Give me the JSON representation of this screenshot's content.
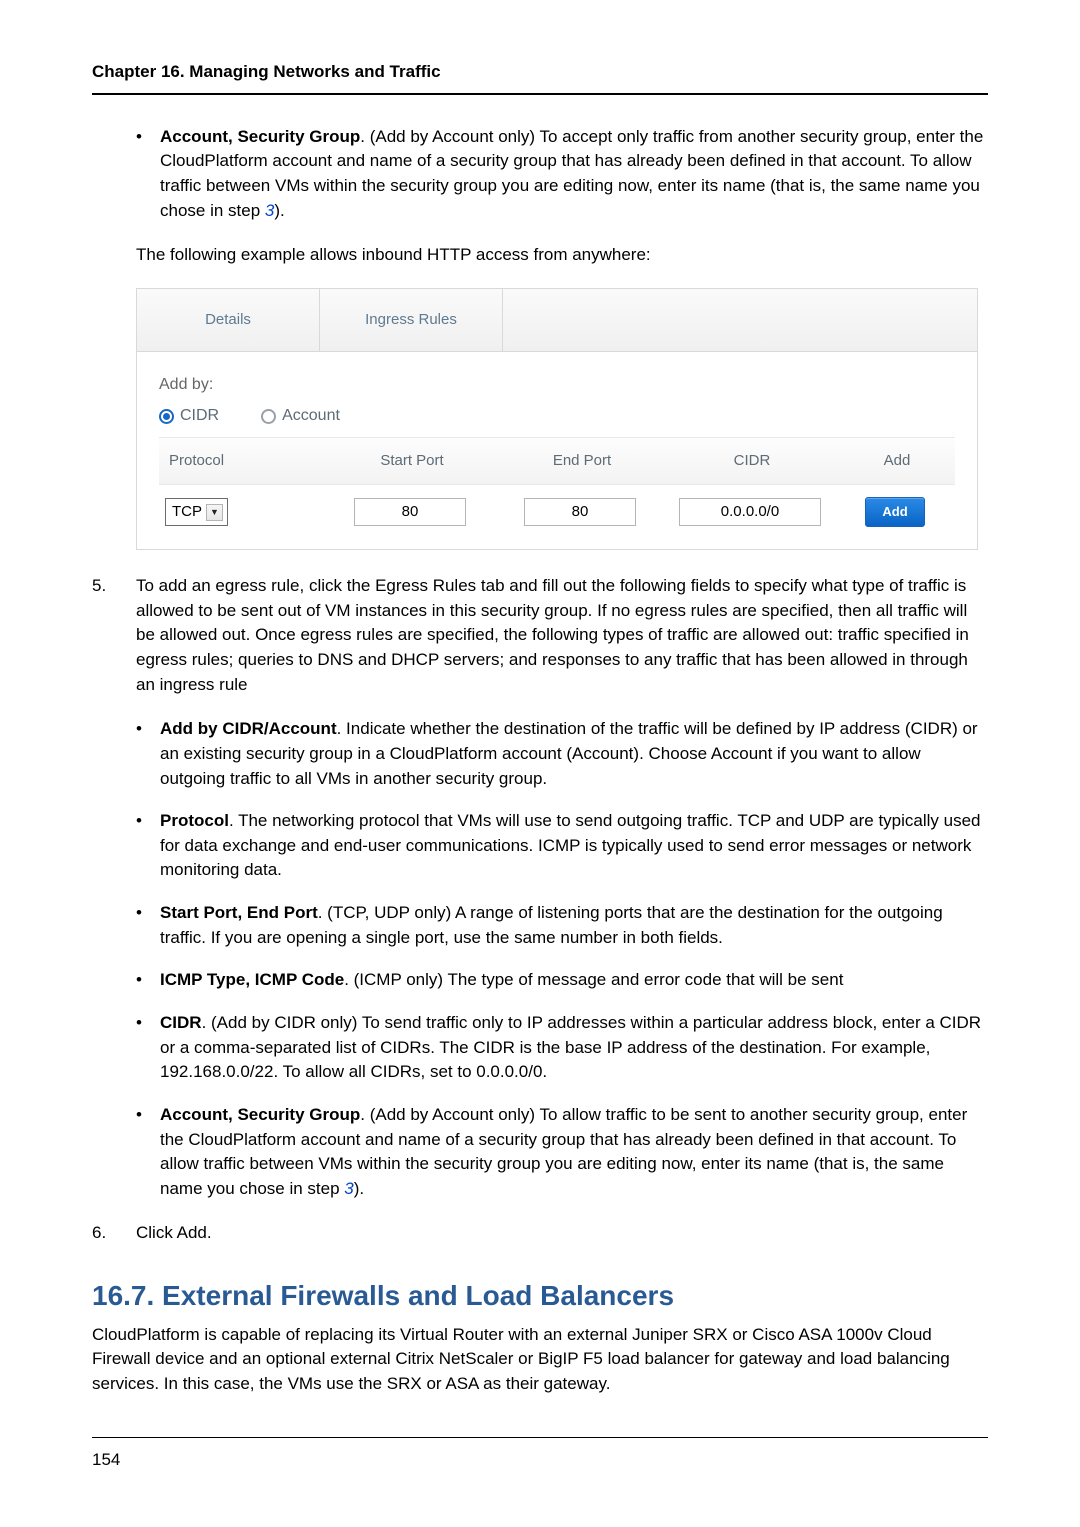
{
  "page": {
    "chapter_header": "Chapter 16. Managing Networks and Traffic",
    "page_number": "154"
  },
  "intro_bullet": {
    "label": "Account, Security Group",
    "text": ". (Add by Account only) To accept only traffic from another security group, enter the CloudPlatform account and name of a security group that has already been defined in that account. To allow traffic between VMs within the security group you are editing now, enter its name (that is, the same name you chose in step ",
    "link": "3",
    "close": ")."
  },
  "example_line": "The following example allows inbound HTTP access from anywhere:",
  "screenshot": {
    "tabs": {
      "details": "Details",
      "ingress": "Ingress Rules"
    },
    "addby_label": "Add by:",
    "radio_cidr": "CIDR",
    "radio_account": "Account",
    "heads": {
      "protocol": "Protocol",
      "start": "Start Port",
      "end": "End Port",
      "cidr": "CIDR",
      "add": "Add"
    },
    "row": {
      "protocol": "TCP",
      "start": "80",
      "end": "80",
      "cidr": "0.0.0.0/0",
      "add": "Add"
    }
  },
  "step5": {
    "num": "5.",
    "text": "To add an egress rule, click the Egress Rules tab and fill out the following fields to specify what type of traffic is allowed to be sent out of VM instances in this security group. If no egress rules are specified, then all traffic will be allowed out. Once egress rules are specified, the following types of traffic are allowed out: traffic specified in egress rules; queries to DNS and DHCP servers; and responses to any traffic that has been allowed in through an ingress rule",
    "bullets": {
      "b1_label": "Add by CIDR/Account",
      "b1_text": ". Indicate whether the destination of the traffic will be defined by IP address (CIDR) or an existing security group in a CloudPlatform account (Account). Choose Account if you want to allow outgoing traffic to all VMs in another security group.",
      "b2_label": "Protocol",
      "b2_text": ". The networking protocol that VMs will use to send outgoing traffic. TCP and UDP are typically used for data exchange and end-user communications. ICMP is typically used to send error messages or network monitoring data.",
      "b3_label": "Start Port, End Port",
      "b3_text": ". (TCP, UDP only) A range of listening ports that are the destination for the outgoing traffic. If you are opening a single port, use the same number in both fields.",
      "b4_label": "ICMP Type, ICMP Code",
      "b4_text": ". (ICMP only) The type of message and error code that will be sent",
      "b5_label": "CIDR",
      "b5_text": ". (Add by CIDR only) To send traffic only to IP addresses within a particular address block, enter a CIDR or a comma-separated list of CIDRs. The CIDR is the base IP address of the destination. For example, 192.168.0.0/22. To allow all CIDRs, set to 0.0.0.0/0.",
      "b6_label": "Account, Security Group",
      "b6_text": ". (Add by Account only) To allow traffic to be sent to another security group, enter the CloudPlatform account and name of a security group that has already been defined in that account. To allow traffic between VMs within the security group you are editing now, enter its name (that is, the same name you chose in step ",
      "b6_link": "3",
      "b6_close": ")."
    }
  },
  "step6": {
    "num": "6.",
    "text": "Click Add."
  },
  "section": {
    "title": "16.7. External Firewalls and Load Balancers",
    "body": "CloudPlatform is capable of replacing its Virtual Router with an external Juniper SRX or Cisco ASA 1000v Cloud Firewall device and an optional external Citrix NetScaler or BigIP F5 load balancer for gateway and load balancing services. In this case, the VMs use the SRX or ASA as their gateway."
  }
}
